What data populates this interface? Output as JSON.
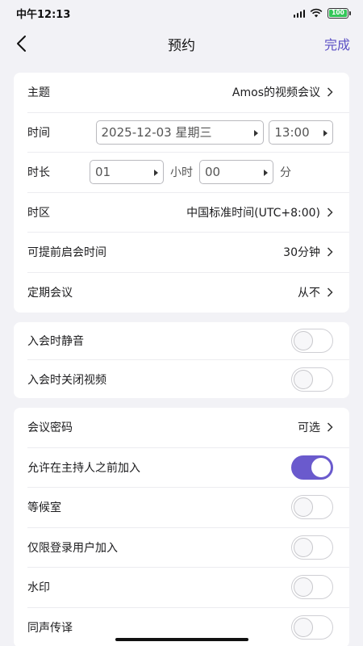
{
  "status_bar": {
    "time": "中午12:13",
    "battery": "100"
  },
  "nav": {
    "title": "预约",
    "done": "完成"
  },
  "basic": {
    "topic_label": "主题",
    "topic_value": "Amos的视频会议",
    "time_label": "时间",
    "date_value": "2025-12-03 星期三",
    "time_value": "13:00",
    "duration_label": "时长",
    "hours_value": "01",
    "hours_unit": "小时",
    "minutes_value": "00",
    "minutes_unit": "分",
    "timezone_label": "时区",
    "timezone_value": "中国标准时间(UTC+8:00)",
    "early_start_label": "可提前启会时间",
    "early_start_value": "30分钟",
    "recurring_label": "定期会议",
    "recurring_value": "从不"
  },
  "join_settings": {
    "mute_label": "入会时静音",
    "mute_on": false,
    "video_off_label": "入会时关闭视频",
    "video_off_on": false
  },
  "security": {
    "password_label": "会议密码",
    "password_value": "可选",
    "join_before_host_label": "允许在主持人之前加入",
    "join_before_host_on": true,
    "waiting_room_label": "等候室",
    "waiting_room_on": false,
    "signed_in_only_label": "仅限登录用户加入",
    "signed_in_only_on": false,
    "watermark_label": "水印",
    "watermark_on": false,
    "interpretation_label": "同声传译",
    "interpretation_on": false
  },
  "colors": {
    "accent": "#6a5acd",
    "background": "#f2f2f6",
    "battery": "#34c759"
  }
}
